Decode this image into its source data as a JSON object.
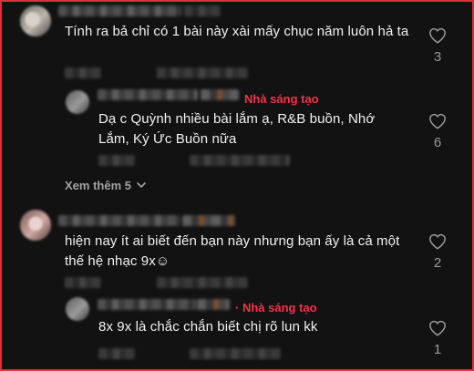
{
  "comments": [
    {
      "text": "Tính ra bả chỉ có 1 bài này xài mấy chục năm luôn hả ta",
      "likes": "3",
      "reply": {
        "creator_label": "Nhà sáng tạo",
        "text": "Dạ c Quỳnh nhiều bài lắm ạ, R&B buồn, Nhớ Lắm, Ký Ức Buồn nữa",
        "likes": "6"
      },
      "see_more": "Xem thêm 5"
    },
    {
      "text": "hiện nay ít ai biết đến bạn này nhưng bạn ấy là cả một thế hệ nhạc 9x☺",
      "likes": "2",
      "reply": {
        "creator_label": "· Nhà sáng tạo",
        "text": "8x 9x là chắc chắn biết chị rõ lun kk",
        "likes": "1"
      }
    }
  ],
  "icons": {
    "like": "heart-outline-icon",
    "expand": "chevron-down-icon"
  },
  "colors": {
    "background": "#121212",
    "creator": "#f2334a",
    "border": "#d8313b"
  }
}
